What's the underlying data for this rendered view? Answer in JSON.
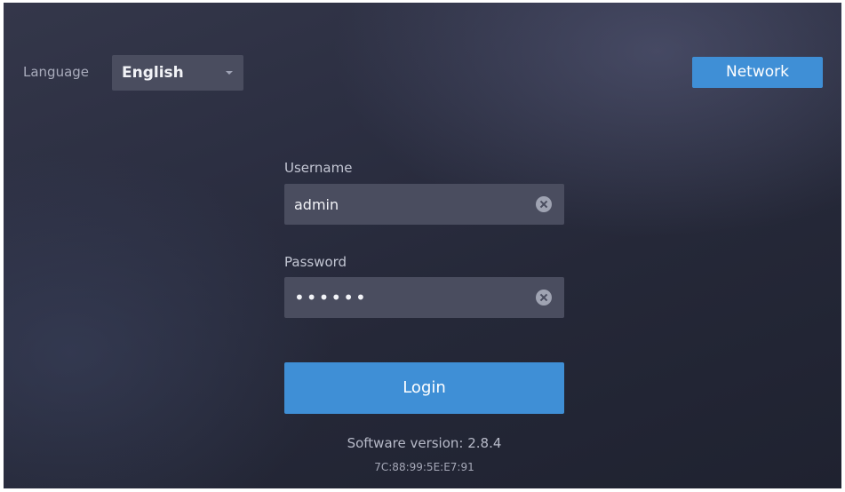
{
  "header": {
    "language_label": "Language",
    "language_value": "English",
    "network_label": "Network"
  },
  "form": {
    "username_label": "Username",
    "username_value": "admin",
    "password_label": "Password",
    "password_value": "••••••",
    "login_label": "Login"
  },
  "footer": {
    "version": "Software version: 2.8.4",
    "mac": "7C:88:99:5E:E7:91"
  },
  "colors": {
    "accent": "#3f8fd6",
    "field_bg": "#4a4d5f",
    "background": "#2a2d3e"
  },
  "icons": {
    "dropdown": "chevron-down-icon",
    "clear": "clear-icon"
  }
}
